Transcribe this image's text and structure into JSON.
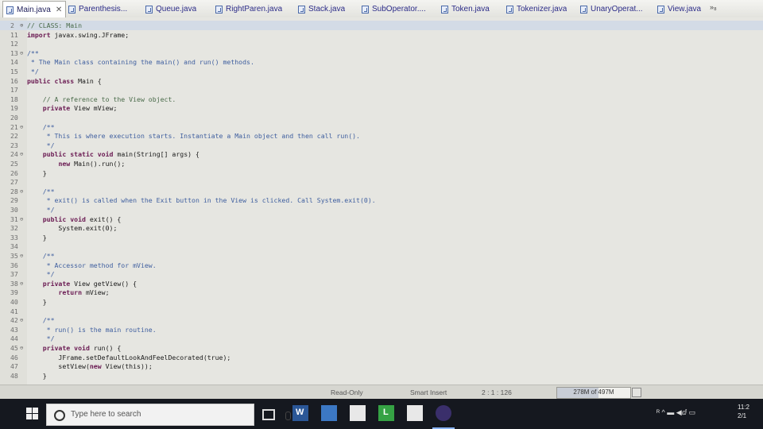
{
  "tabs": [
    {
      "label": "Main.java",
      "active": true
    },
    {
      "label": "Parenthesis..."
    },
    {
      "label": "Queue.java"
    },
    {
      "label": "RightParen.java"
    },
    {
      "label": "Stack.java"
    },
    {
      "label": "SubOperator...."
    },
    {
      "label": "Token.java"
    },
    {
      "label": "Tokenizer.java"
    },
    {
      "label": "UnaryOperat..."
    },
    {
      "label": "View.java"
    }
  ],
  "tab_close": "✕",
  "tab_overflow": "»₈",
  "lines": [
    {
      "n": "2",
      "text": "// CLASS: Main",
      "fold": "⊕",
      "highlight": true
    },
    {
      "n": "11",
      "text": "import javax.swing.JFrame;"
    },
    {
      "n": "12",
      "text": ""
    },
    {
      "n": "13",
      "text": "/**",
      "fold": "⊖"
    },
    {
      "n": "14",
      "text": " * The Main class containing the main() and run() methods."
    },
    {
      "n": "15",
      "text": " */"
    },
    {
      "n": "16",
      "text": "public class Main {"
    },
    {
      "n": "17",
      "text": ""
    },
    {
      "n": "18",
      "text": "    // A reference to the View object."
    },
    {
      "n": "19",
      "text": "    private View mView;"
    },
    {
      "n": "20",
      "text": ""
    },
    {
      "n": "21",
      "text": "    /**",
      "fold": "⊖"
    },
    {
      "n": "22",
      "text": "     * This is where execution starts. Instantiate a Main object and then call run()."
    },
    {
      "n": "23",
      "text": "     */"
    },
    {
      "n": "24",
      "text": "    public static void main(String[] args) {",
      "fold": "⊖"
    },
    {
      "n": "25",
      "text": "        new Main().run();"
    },
    {
      "n": "26",
      "text": "    }"
    },
    {
      "n": "27",
      "text": ""
    },
    {
      "n": "28",
      "text": "    /**",
      "fold": "⊖"
    },
    {
      "n": "29",
      "text": "     * exit() is called when the Exit button in the View is clicked. Call System.exit(0)."
    },
    {
      "n": "30",
      "text": "     */"
    },
    {
      "n": "31",
      "text": "    public void exit() {",
      "fold": "⊖"
    },
    {
      "n": "32",
      "text": "        System.exit(0);"
    },
    {
      "n": "33",
      "text": "    }"
    },
    {
      "n": "34",
      "text": ""
    },
    {
      "n": "35",
      "text": "    /**",
      "fold": "⊖"
    },
    {
      "n": "36",
      "text": "     * Accessor method for mView."
    },
    {
      "n": "37",
      "text": "     */"
    },
    {
      "n": "38",
      "text": "    private View getView() {",
      "fold": "⊖"
    },
    {
      "n": "39",
      "text": "        return mView;"
    },
    {
      "n": "40",
      "text": "    }"
    },
    {
      "n": "41",
      "text": ""
    },
    {
      "n": "42",
      "text": "    /**",
      "fold": "⊖"
    },
    {
      "n": "43",
      "text": "     * run() is the main routine."
    },
    {
      "n": "44",
      "text": "     */"
    },
    {
      "n": "45",
      "text": "    private void run() {",
      "fold": "⊖"
    },
    {
      "n": "46",
      "text": "        JFrame.setDefaultLookAndFeelDecorated(true);"
    },
    {
      "n": "47",
      "text": "        setView(new View(this));"
    },
    {
      "n": "48",
      "text": "    }"
    }
  ],
  "status": {
    "mode": "Read-Only",
    "insert": "Smart Insert",
    "position": "2 : 1 : 126",
    "heap": "278M of 497M",
    "heap_fraction": 0.56
  },
  "taskbar": {
    "search_placeholder": "Type here to search",
    "tray": "ᴿ ^ ▬ ◀ⅆ ▭",
    "clock_time": "11:2",
    "clock_date": "2/1"
  }
}
